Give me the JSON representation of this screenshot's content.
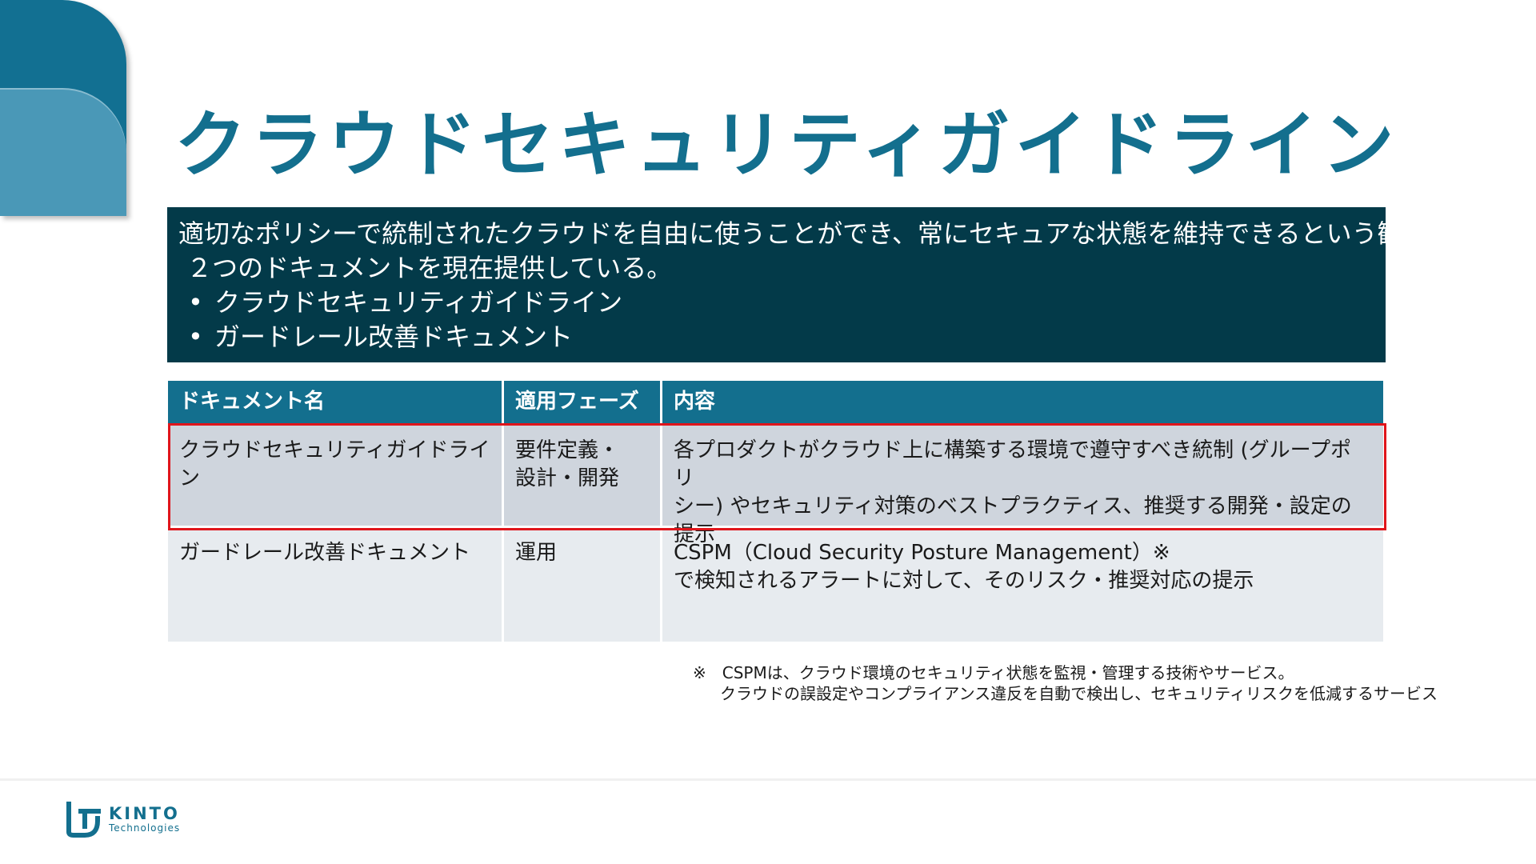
{
  "slide": {
    "title": "クラウドセキュリティガイドライン",
    "summary": {
      "line1": "適切なポリシーで統制されたクラウドを自由に使うことができ、常にセキュアな状態を維持できるという観点で、",
      "line2": "２つのドキュメントを現在提供している。",
      "bullets": [
        "クラウドセキュリティガイドライン",
        "ガードレール改善ドキュメント"
      ],
      "bullet_char": "•"
    },
    "table": {
      "headers": [
        "ドキュメント名",
        "適用フェーズ",
        "内容"
      ],
      "rows": [
        {
          "name": "クラウドセキュリティガイドライン",
          "phase_l1": "要件定義・",
          "phase_l2": "設計・開発",
          "content_l1": "各プロダクトがクラウド上に構築する環境で遵守すべき統制 (グループポリ",
          "content_l2": "シー) やセキュリティ対策のベストプラクティス、推奨する開発・設定の提示"
        },
        {
          "name": "ガードレール改善ドキュメント",
          "phase_l1": "運用",
          "phase_l2": "",
          "content_l1": "CSPM（Cloud Security Posture Management）※",
          "content_l2": "で検知されるアラートに対して、そのリスク・推奨対応の提示"
        }
      ]
    },
    "note": {
      "line1": "※　CSPMは、クラウド環境のセキュリティ状態を監視・管理する技術やサービス。",
      "line2": "クラウドの誤設定やコンプライアンス違反を自動で検出し、セキュリティリスクを低減するサービス"
    },
    "logo": {
      "name": "KINTO",
      "sub": "Technologies"
    },
    "colors": {
      "brand": "#136f8e",
      "summary_bg": "#033a49",
      "highlight": "#e0151b"
    }
  }
}
